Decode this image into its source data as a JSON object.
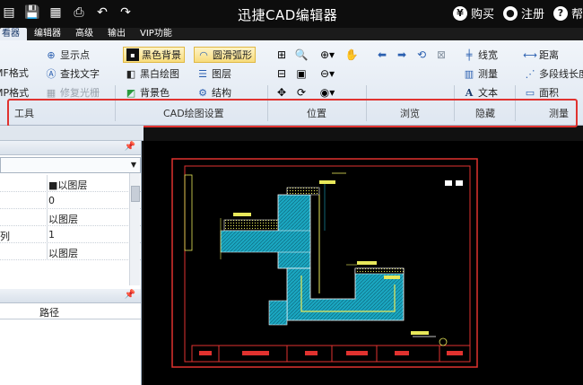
{
  "title": "迅捷CAD编辑器",
  "title_actions": [
    {
      "icon": "yen-icon",
      "glyph": "¥",
      "label": "购买"
    },
    {
      "icon": "user-icon",
      "glyph": "●",
      "label": "注册"
    },
    {
      "icon": "help-icon",
      "glyph": "?",
      "label": "帮"
    }
  ],
  "tabs": [
    "看器",
    "编辑器",
    "高级",
    "输出",
    "VIP功能"
  ],
  "ribbon": {
    "tools": {
      "mf_format": "MF格式",
      "mp_format": "MP格式",
      "show_points": "显示点",
      "find_text": "查找文字",
      "shx_fonts": "修复光栅"
    },
    "cad_settings": {
      "black_bg": "黑色背景",
      "smooth_arc": "圆滑弧形",
      "bw_draw": "黑白绘图",
      "layers": "图层",
      "bg_color": "背景色",
      "structure": "结构"
    },
    "hidden": {
      "line_width": "线宽",
      "measure": "测量",
      "text": "文本"
    },
    "measure": {
      "distance": "距离",
      "polyline_length": "多段线长度",
      "area": "面积"
    }
  },
  "group_labels": [
    "工具",
    "CAD绘图设置",
    "位置",
    "浏览",
    "隐藏",
    "测量"
  ],
  "properties": {
    "rows": [
      {
        "key": "",
        "value": "■以图层"
      },
      {
        "key": "",
        "value": "0"
      },
      {
        "key": "",
        "value": "以图层"
      },
      {
        "key": "列",
        "value": "1"
      },
      {
        "key": "",
        "value": "以图层"
      }
    ]
  },
  "files_panel": {
    "column": "路径"
  },
  "colors": {
    "accent_red": "#e0322f",
    "ribbon_bg": "#e4ebf4"
  }
}
